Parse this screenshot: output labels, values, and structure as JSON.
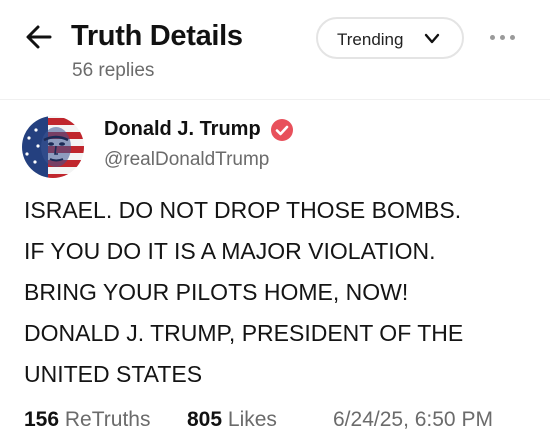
{
  "header": {
    "title": "Truth Details",
    "reply_count": "56 replies",
    "sort_label": "Trending",
    "back_icon": "arrow-left-icon",
    "sort_icon": "chevron-down-icon",
    "more_icon": "more-horizontal-icon"
  },
  "post": {
    "author": {
      "display_name": "Donald J. Trump",
      "handle": "@realDonaldTrump",
      "verified": true,
      "verified_color": "#e8505b",
      "avatar_icon": "avatar-flag-portrait"
    },
    "lines": [
      "ISRAEL. DO NOT DROP THOSE BOMBS.",
      "IF YOU DO IT IS A MAJOR VIOLATION.",
      "BRING YOUR PILOTS HOME, NOW!",
      "DONALD J. TRUMP, PRESIDENT OF THE",
      "UNITED STATES"
    ],
    "stats": {
      "retruths_count": "156",
      "retruths_label": "ReTruths",
      "likes_count": "805",
      "likes_label": "Likes",
      "timestamp": "6/24/25, 6:50 PM"
    }
  }
}
